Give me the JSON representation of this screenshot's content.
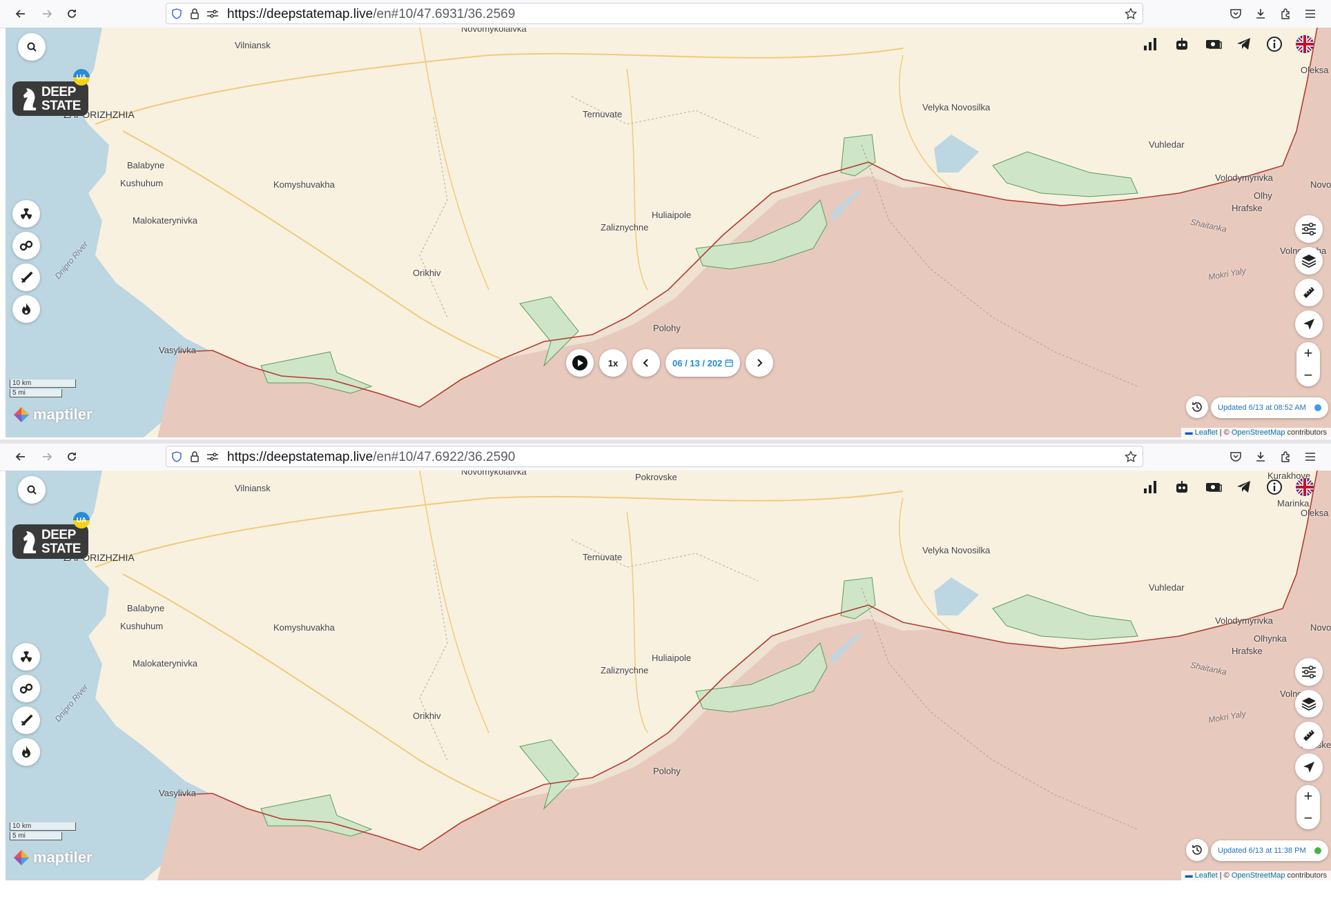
{
  "panes": [
    {
      "url_host": "https://deepstatemap.live",
      "url_path": "/en#10/47.6931/36.2569",
      "show_playbar": true,
      "playbar": {
        "speed": "1x",
        "date": "06 / 13 / 202"
      },
      "updated_text": "Updated 6/13 at 08:52 AM",
      "updated_dot_color": "#3b9bea",
      "labels": {
        "novomykolaivka": "Novomykolaivka",
        "pokrovske": "",
        "kurakhove": "",
        "marinka": "",
        "oleksa": "Oleksa",
        "olkhynka": "Olhy",
        "novo": "Novo",
        "volnovakha": "Volnovakha",
        "donske": ""
      }
    },
    {
      "url_host": "https://deepstatemap.live",
      "url_path": "/en#10/47.6922/36.2590",
      "show_playbar": false,
      "playbar": {
        "speed": "",
        "date": ""
      },
      "updated_text": "Updated 6/13 at 11:38 PM",
      "updated_dot_color": "#4caf50",
      "labels": {
        "novomykolaivka": "Novomykolaivka",
        "pokrovske": "Pokrovske",
        "kurakhove": "Kurakhove",
        "marinka": "Marinka",
        "oleksa": "Oleksa",
        "olkhynka": "Olhynka",
        "novo": "Novo",
        "volnovakha": "Volnova",
        "donske": "Donske"
      }
    }
  ],
  "map_labels": {
    "vilniansk": "Vilniansk",
    "zaporizhzhia": "ZAPORIZHZHIA",
    "balabyne": "Balabyne",
    "kushuhum": "Kushuhum",
    "komyshuvakha": "Komyshuvakha",
    "malokaterynivka": "Malokaterynivka",
    "dnipro_river": "Dnipro River",
    "orikhiv": "Orikhiv",
    "vasylivka": "Vasylivka",
    "polohy": "Polohy",
    "ternuvate": "Ternuvate",
    "zaliznychne": "Zaliznychne",
    "huliaipole": "Huliaipole",
    "velyka_novosilka": "Velyka Novosilka",
    "vuhledar": "Vuhledar",
    "volodymyrivka": "Volodymyrivka",
    "hrafske": "Hrafske",
    "shaitanka": "Shaitanka",
    "mokri_yaly": "Mokri Yaly"
  },
  "logo": {
    "line1": "DEEP",
    "line2": "STATE",
    "badge": "UA"
  },
  "scale": {
    "km": "10 km",
    "mi": "5 mi"
  },
  "maptiler": "maptiler",
  "attribution": {
    "leaflet": "Leaflet",
    "sep": " | © ",
    "osm": "OpenStreetMap",
    "contrib": " contributors"
  },
  "colors": {
    "land": "#f8f1e0",
    "occupied": "#e8c9bd",
    "liberated": "#cfe5c7",
    "contested": "#eee2d2",
    "water": "#bcd6e2",
    "frontline": "#b33a2e"
  },
  "icons": {
    "left_tools": [
      "radiation-icon",
      "handcuffs-icon",
      "missile-icon",
      "fire-icon"
    ],
    "top_tools": [
      "chart-icon",
      "bot-icon",
      "donate-icon",
      "telegram-icon",
      "info-icon",
      "uk-flag-icon"
    ],
    "right_tools": [
      "filter-icon",
      "layers-icon",
      "ruler-icon",
      "locate-icon"
    ]
  }
}
